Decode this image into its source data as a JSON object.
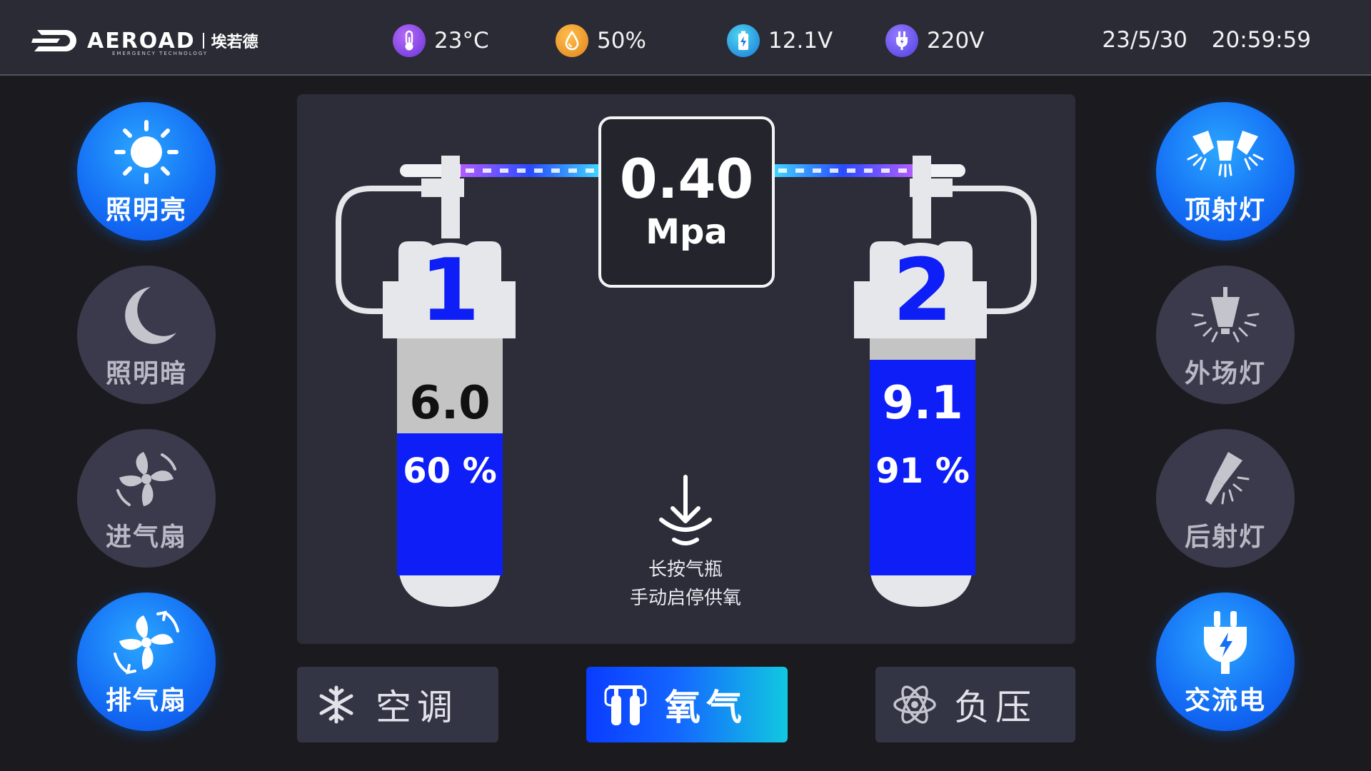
{
  "header": {
    "brand": "AEROAD",
    "brand_sub": "EMERGENCY TECHNOLOGY",
    "brand_cn": "埃若德",
    "temperature": "23°C",
    "humidity": "50%",
    "battery_voltage": "12.1V",
    "mains_voltage": "220V",
    "date": "23/5/30",
    "time": "20:59:59"
  },
  "left_buttons": [
    {
      "label": "照明亮",
      "icon": "sun-icon",
      "active": true
    },
    {
      "label": "照明暗",
      "icon": "moon-icon",
      "active": false
    },
    {
      "label": "进气扇",
      "icon": "fan-in-icon",
      "active": false
    },
    {
      "label": "排气扇",
      "icon": "fan-out-icon",
      "active": true
    }
  ],
  "right_buttons": [
    {
      "label": "顶射灯",
      "icon": "ceiling-spotlight-icon",
      "active": true
    },
    {
      "label": "外场灯",
      "icon": "floodlight-icon",
      "active": false
    },
    {
      "label": "后射灯",
      "icon": "rear-light-icon",
      "active": false
    },
    {
      "label": "交流电",
      "icon": "ac-plug-icon",
      "active": true
    }
  ],
  "oxygen": {
    "pressure_value": "0.40",
    "pressure_unit": "Mpa",
    "hint_line1": "长按气瓶",
    "hint_line2": "手动启停供氧",
    "cylinders": [
      {
        "number": "1",
        "value": "6.0",
        "percent_label": "60 %",
        "fill_fraction": 0.6
      },
      {
        "number": "2",
        "value": "9.1",
        "percent_label": "91 %",
        "fill_fraction": 0.91
      }
    ]
  },
  "tabs": [
    {
      "label": "空调",
      "icon": "snowflake-icon",
      "active": false
    },
    {
      "label": "氧气",
      "icon": "oxygen-tanks-icon",
      "active": true
    },
    {
      "label": "负压",
      "icon": "atom-icon",
      "active": false
    }
  ],
  "colors": {
    "accent_blue": "#1570f5",
    "fill_blue": "#0e1ef7",
    "inactive_button": "#3a3a4c",
    "panel": "#2c2d39"
  }
}
